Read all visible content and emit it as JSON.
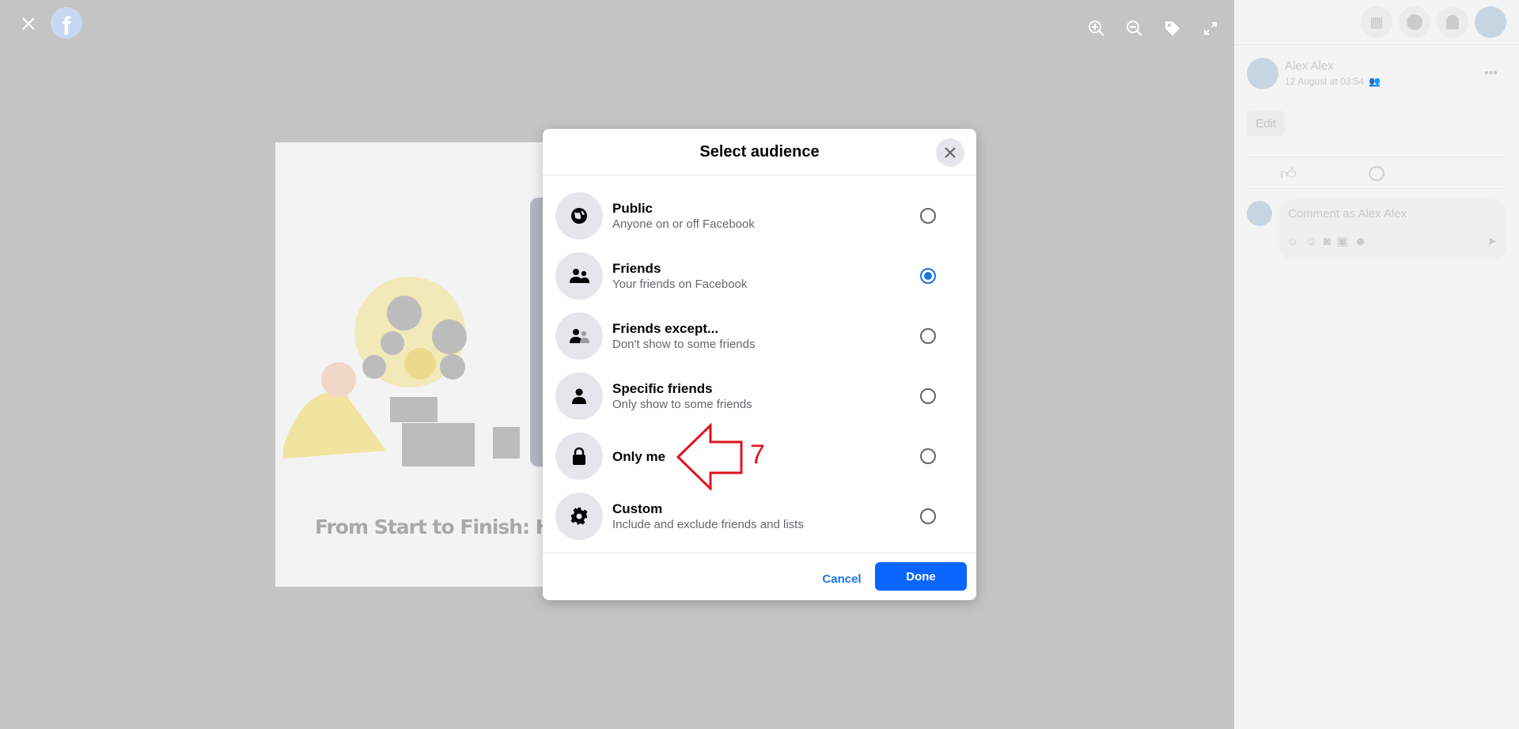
{
  "viewer": {
    "caption": "From Start to Finish: How"
  },
  "panel": {
    "author": "Alex Alex",
    "timestamp": "12 August at 03:54",
    "edit_label": "Edit",
    "comment_placeholder": "Comment as Alex Alex"
  },
  "dialog": {
    "title": "Select audience",
    "options": [
      {
        "label": "Public",
        "sub": "Anyone on or off Facebook",
        "icon": "globe-icon",
        "selected": false
      },
      {
        "label": "Friends",
        "sub": "Your friends on Facebook",
        "icon": "friends-icon",
        "selected": true
      },
      {
        "label": "Friends except...",
        "sub": "Don't show to some friends",
        "icon": "friends-except-icon",
        "selected": false
      },
      {
        "label": "Specific friends",
        "sub": "Only show to some friends",
        "icon": "person-icon",
        "selected": false
      },
      {
        "label": "Only me",
        "sub": "",
        "icon": "lock-icon",
        "selected": false
      },
      {
        "label": "Custom",
        "sub": "Include and exclude friends and lists",
        "icon": "gear-icon",
        "selected": false
      }
    ],
    "cancel_label": "Cancel",
    "done_label": "Done"
  },
  "annotation": {
    "step": "7",
    "color": "#e0141e"
  },
  "colors": {
    "accent": "#0866ff",
    "radio": "#1b74e4"
  }
}
